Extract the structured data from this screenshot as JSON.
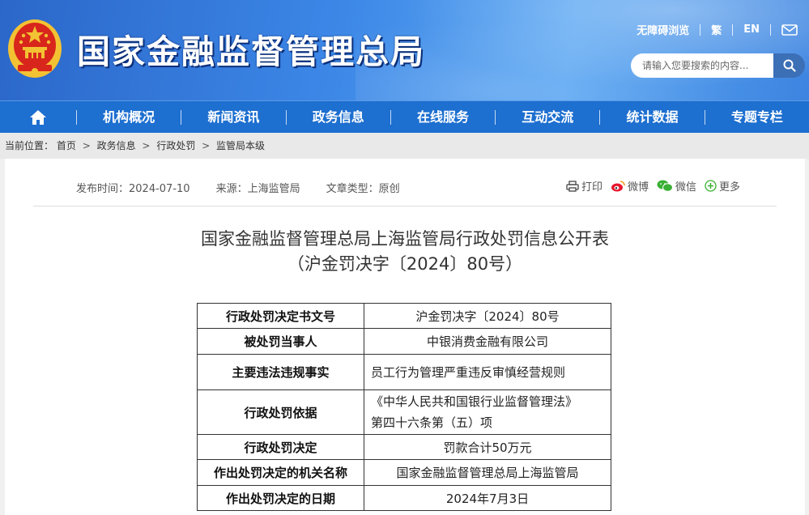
{
  "header": {
    "site_title": "国家金融监督管理总局",
    "links": {
      "accessibility": "无障碍浏览",
      "traditional": "繁",
      "english": "EN"
    },
    "search": {
      "placeholder": "请输入您要搜索的内容..."
    }
  },
  "nav": {
    "items": [
      "机构概况",
      "新闻资讯",
      "政务信息",
      "在线服务",
      "互动交流",
      "统计数据",
      "专题专栏"
    ]
  },
  "breadcrumb": {
    "label": "当前位置：",
    "items": [
      "首页",
      "政务信息",
      "行政处罚",
      "监管局本级"
    ],
    "sep": ">"
  },
  "article": {
    "meta": {
      "date": "发布时间：2024-07-10",
      "source": "来源：上海监管局",
      "type": "文章类型：原创"
    },
    "share": {
      "print": "打印",
      "weibo": "微博",
      "wechat": "微信",
      "more": "更多"
    },
    "title_line1": "国家金融监督管理总局上海监管局行政处罚信息公开表",
    "title_line2": "（沪金罚决字〔2024〕80号）",
    "table": [
      {
        "key": "行政处罚决定书文号",
        "value": "沪金罚决字〔2024〕80号"
      },
      {
        "key": "被处罚当事人",
        "value": "中银消费金融有限公司"
      },
      {
        "key": "主要违法违规事实",
        "value": "员工行为管理严重违反审慎经营规则"
      },
      {
        "key": "行政处罚依据",
        "value_line1": "《中华人民共和国银行业监督管理法》",
        "value_line2": "第四十六条第（五）项"
      },
      {
        "key": "行政处罚决定",
        "value": "罚款合计50万元"
      },
      {
        "key": "作出处罚决定的机关名称",
        "value": "国家金融监督管理总局上海监管局"
      },
      {
        "key": "作出处罚决定的日期",
        "value": "2024年7月3日"
      }
    ]
  },
  "colors": {
    "header_blue": "#3b86e6",
    "nav_blue": "#1d6fd0",
    "emblem_red": "#d8261c",
    "emblem_gold": "#f3c233"
  }
}
